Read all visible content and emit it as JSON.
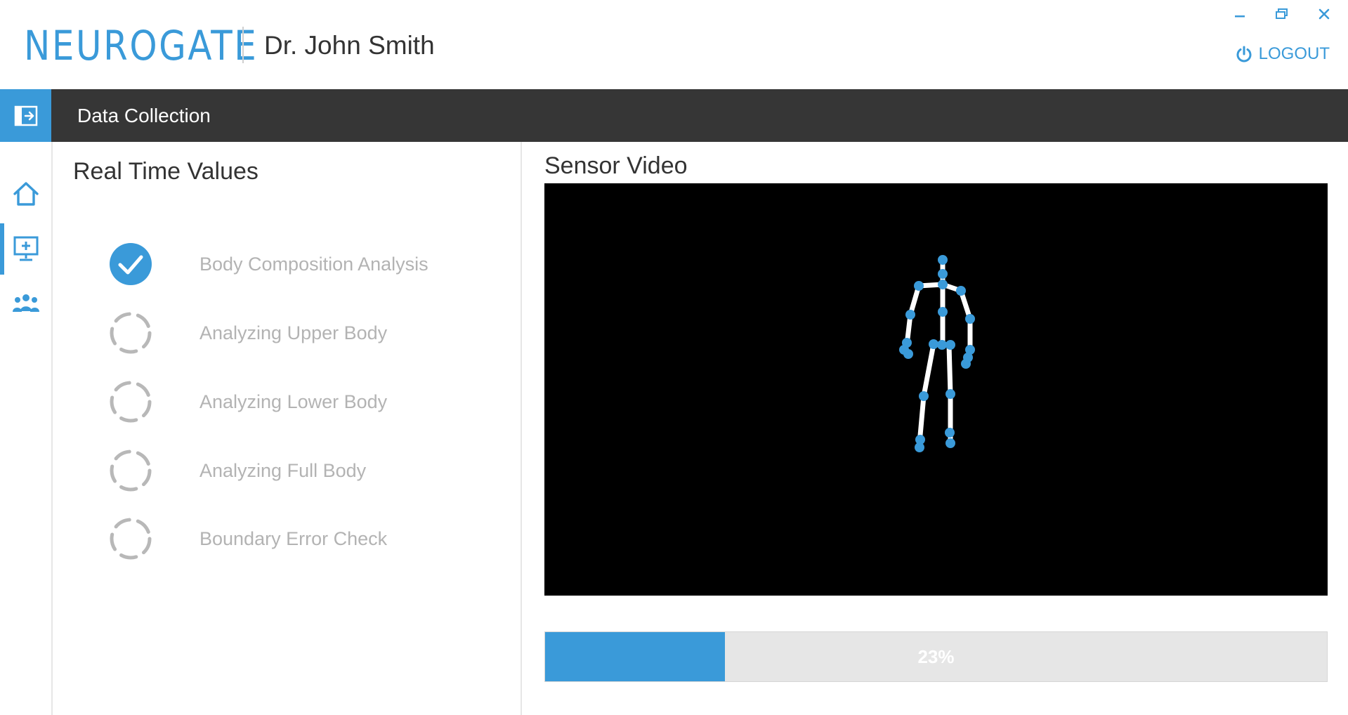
{
  "header": {
    "logo_text": "NEUROGATE",
    "user_name": "Dr. John Smith",
    "logout_label": "LOGOUT"
  },
  "titlebar": {
    "title": "Data Collection"
  },
  "sidebar": {
    "items": [
      {
        "icon": "home-icon"
      },
      {
        "icon": "monitor-add-icon",
        "active": true
      },
      {
        "icon": "users-icon"
      }
    ]
  },
  "left_panel": {
    "title": "Real Time Values",
    "steps": [
      {
        "label": "Body Composition Analysis",
        "status": "complete"
      },
      {
        "label": "Analyzing Upper Body",
        "status": "pending"
      },
      {
        "label": "Analyzing Lower Body",
        "status": "pending"
      },
      {
        "label": "Analyzing Full Body",
        "status": "pending"
      },
      {
        "label": "Boundary Error Check",
        "status": "pending"
      }
    ]
  },
  "right_panel": {
    "title": "Sensor Video",
    "progress": {
      "percent": 23,
      "label": "23%"
    }
  },
  "colors": {
    "accent": "#3a9ad9",
    "titlebar": "#363636",
    "muted_text": "#b3b3b3",
    "progress_track": "#e6e6e6"
  }
}
